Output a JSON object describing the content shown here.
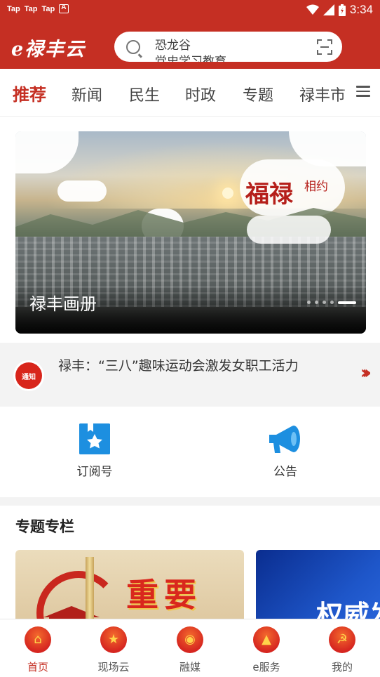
{
  "status_bar": {
    "apps": [
      "Tap",
      "Tap",
      "Tap"
    ],
    "time": "3:34"
  },
  "header": {
    "logo": "e禄丰云",
    "search_line1": "恐龙谷",
    "search_line2": "党史学习教育"
  },
  "tabs": [
    "推荐",
    "新闻",
    "民生",
    "时政",
    "专题",
    "禄丰市"
  ],
  "banner": {
    "caption": "禄丰画册",
    "brand_main": "福禄",
    "brand_side": "相约",
    "page_count": 5,
    "active_page": 5
  },
  "ticker": {
    "badge": "通知",
    "text": "禄丰：“三八”趣味运动会激发女职工活力"
  },
  "quick_entries": [
    {
      "label": "订阅号",
      "icon": "subscription-icon"
    },
    {
      "label": "公告",
      "icon": "megaphone-icon"
    }
  ],
  "special": {
    "title": "专题专栏",
    "card1_title": "重要",
    "card2_title": "权威发"
  },
  "bottom_nav": [
    {
      "label": "首页",
      "icon": "home-icon",
      "active": true
    },
    {
      "label": "现场云",
      "icon": "live-cloud-icon",
      "active": false
    },
    {
      "label": "融媒",
      "icon": "media-icon",
      "active": false
    },
    {
      "label": "e服务",
      "icon": "service-icon",
      "active": false
    },
    {
      "label": "我的",
      "icon": "profile-icon",
      "active": false
    }
  ],
  "colors": {
    "brand_red": "#c52f23",
    "accent_blue": "#1d8fe0"
  }
}
